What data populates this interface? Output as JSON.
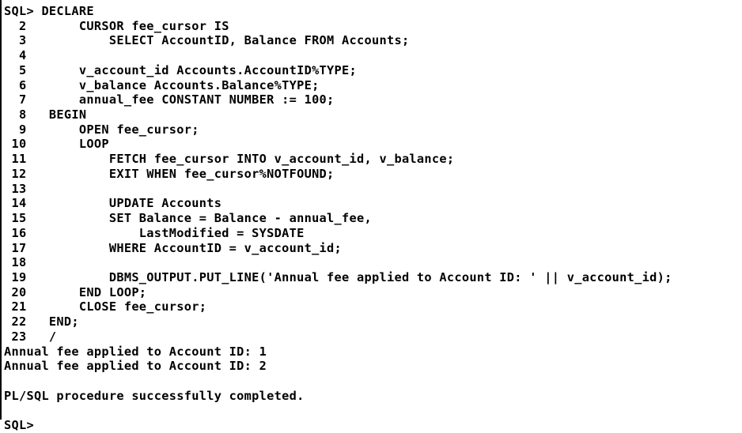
{
  "terminal": {
    "lines": [
      "SQL> DECLARE",
      "  2       CURSOR fee_cursor IS",
      "  3           SELECT AccountID, Balance FROM Accounts;",
      "  4",
      "  5       v_account_id Accounts.AccountID%TYPE;",
      "  6       v_balance Accounts.Balance%TYPE;",
      "  7       annual_fee CONSTANT NUMBER := 100;",
      "  8   BEGIN",
      "  9       OPEN fee_cursor;",
      " 10       LOOP",
      " 11           FETCH fee_cursor INTO v_account_id, v_balance;",
      " 12           EXIT WHEN fee_cursor%NOTFOUND;",
      " 13",
      " 14           UPDATE Accounts",
      " 15           SET Balance = Balance - annual_fee,",
      " 16               LastModified = SYSDATE",
      " 17           WHERE AccountID = v_account_id;",
      " 18",
      " 19           DBMS_OUTPUT.PUT_LINE('Annual fee applied to Account ID: ' || v_account_id);",
      " 20       END LOOP;",
      " 21       CLOSE fee_cursor;",
      " 22   END;",
      " 23   /",
      "Annual fee applied to Account ID: 1",
      "Annual fee applied to Account ID: 2",
      "",
      "PL/SQL procedure successfully completed.",
      "",
      "SQL>"
    ]
  }
}
